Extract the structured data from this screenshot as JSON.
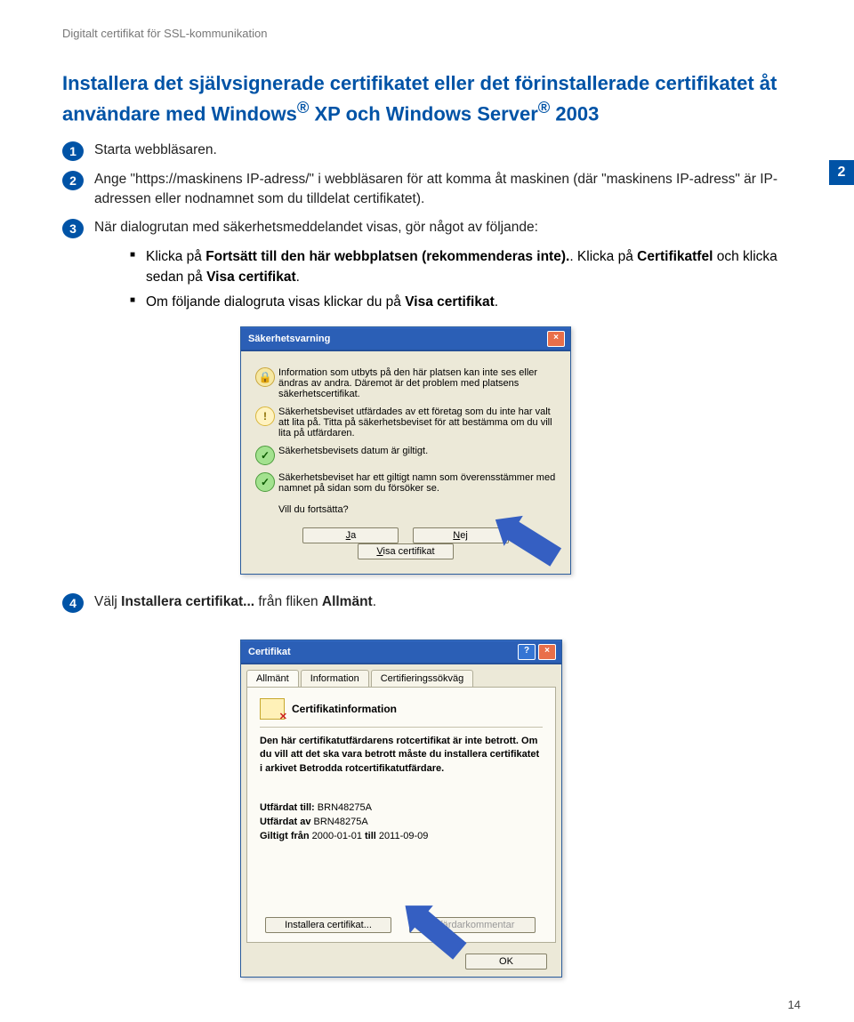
{
  "header": {
    "breadcrumb": "Digitalt certifikat för SSL-kommunikation",
    "title_line1": "Installera det självsignerade certifikatet eller det förinstallerade certifikatet åt användare med Windows",
    "title_reg1": "®",
    "title_xp": " XP och Windows Server",
    "title_reg2": "®",
    "title_year": " 2003"
  },
  "side_page": "2",
  "steps": {
    "s1": {
      "num": "1",
      "text": "Starta webbläsaren."
    },
    "s2": {
      "num": "2",
      "text": "Ange \"https://maskinens IP-adress/\" i webbläsaren för att komma åt maskinen (där \"maskinens IP-adress\" är IP-adressen eller nodnamnet som du tilldelat certifikatet)."
    },
    "s3": {
      "num": "3",
      "text": "När dialogrutan med säkerhetsmeddelandet visas, gör något av följande:"
    },
    "s3_bullets": {
      "b1a": "Klicka på ",
      "b1b": "Fortsätt till den här webbplatsen (rekommenderas inte).",
      "b1c": ". Klicka på ",
      "b1d": "Certifikatfel",
      "b1e": " och klicka sedan på ",
      "b1f": "Visa certifikat",
      "b1g": ".",
      "b2a": "Om följande dialogruta visas klickar du på ",
      "b2b": "Visa certifikat",
      "b2c": "."
    },
    "s4": {
      "num": "4",
      "text_a": "Välj ",
      "text_b": "Installera certifikat...",
      "text_c": " från fliken ",
      "text_d": "Allmänt",
      "text_e": "."
    }
  },
  "dialog1": {
    "title": "Säkerhetsvarning",
    "intro": "Information som utbyts på den här platsen kan inte ses eller ändras av andra. Däremot är det problem med platsens säkerhetscertifikat.",
    "warn": "Säkerhetsbeviset utfärdades av ett företag som du inte har valt att lita på. Titta på säkerhetsbeviset för att bestämma om du vill lita på utfärdaren.",
    "ok1": "Säkerhetsbevisets datum är giltigt.",
    "ok2": "Säkerhetsbeviset har ett giltigt namn som överensstämmer med namnet på sidan som du försöker se.",
    "question": "Vill du fortsätta?",
    "btn_yes": "Ja",
    "btn_no": "Nej",
    "btn_view": "Visa certifikat"
  },
  "dialog2": {
    "title": "Certifikat",
    "tabs": {
      "t1": "Allmänt",
      "t2": "Information",
      "t3": "Certifieringssökväg"
    },
    "heading": "Certifikatinformation",
    "info": "Den här certifikatutfärdarens rotcertifikat är inte betrott. Om du vill att det ska vara betrott måste du installera certifikatet i arkivet Betrodda rotcertifikatutfärdare.",
    "issued_to_label": "Utfärdat till:",
    "issued_to_val": "BRN48275A",
    "issued_by_label": "Utfärdat av",
    "issued_by_val": "BRN48275A",
    "valid_label_a": "Giltigt från",
    "valid_from": "2000-01-01",
    "valid_label_b": "till",
    "valid_to": "2011-09-09",
    "btn_install": "Installera certifikat...",
    "btn_comment": "Utfärdarkommentar",
    "btn_ok": "OK"
  },
  "page_number": "14"
}
